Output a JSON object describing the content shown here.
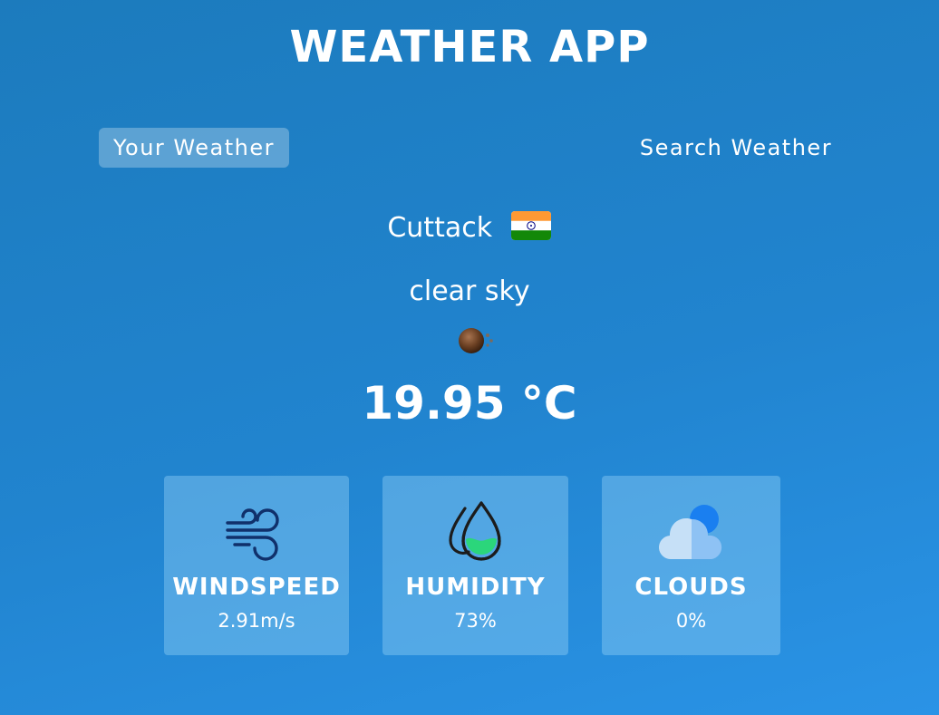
{
  "app": {
    "title": "WEATHER APP"
  },
  "tabs": [
    {
      "label": "Your Weather",
      "active": true
    },
    {
      "label": "Search Weather",
      "active": false
    }
  ],
  "weather": {
    "city": "Cuttack",
    "country_flag_icon": "india-flag-icon",
    "condition": "clear sky",
    "condition_icon": "clear-sky-icon",
    "temperature": "19.95 °C"
  },
  "stats": [
    {
      "label": "WINDSPEED",
      "value": "2.91m/s",
      "icon": "wind-icon"
    },
    {
      "label": "HUMIDITY",
      "value": "73%",
      "icon": "humidity-icon"
    },
    {
      "label": "CLOUDS",
      "value": "0%",
      "icon": "cloud-icon"
    }
  ],
  "colors": {
    "background_top": "#1c7bbd",
    "background_bottom": "#2a93e6",
    "card_background": "#8ccdf5",
    "humidity_fill": "#2bd67b",
    "cloud_accent": "#1a7ff0"
  }
}
